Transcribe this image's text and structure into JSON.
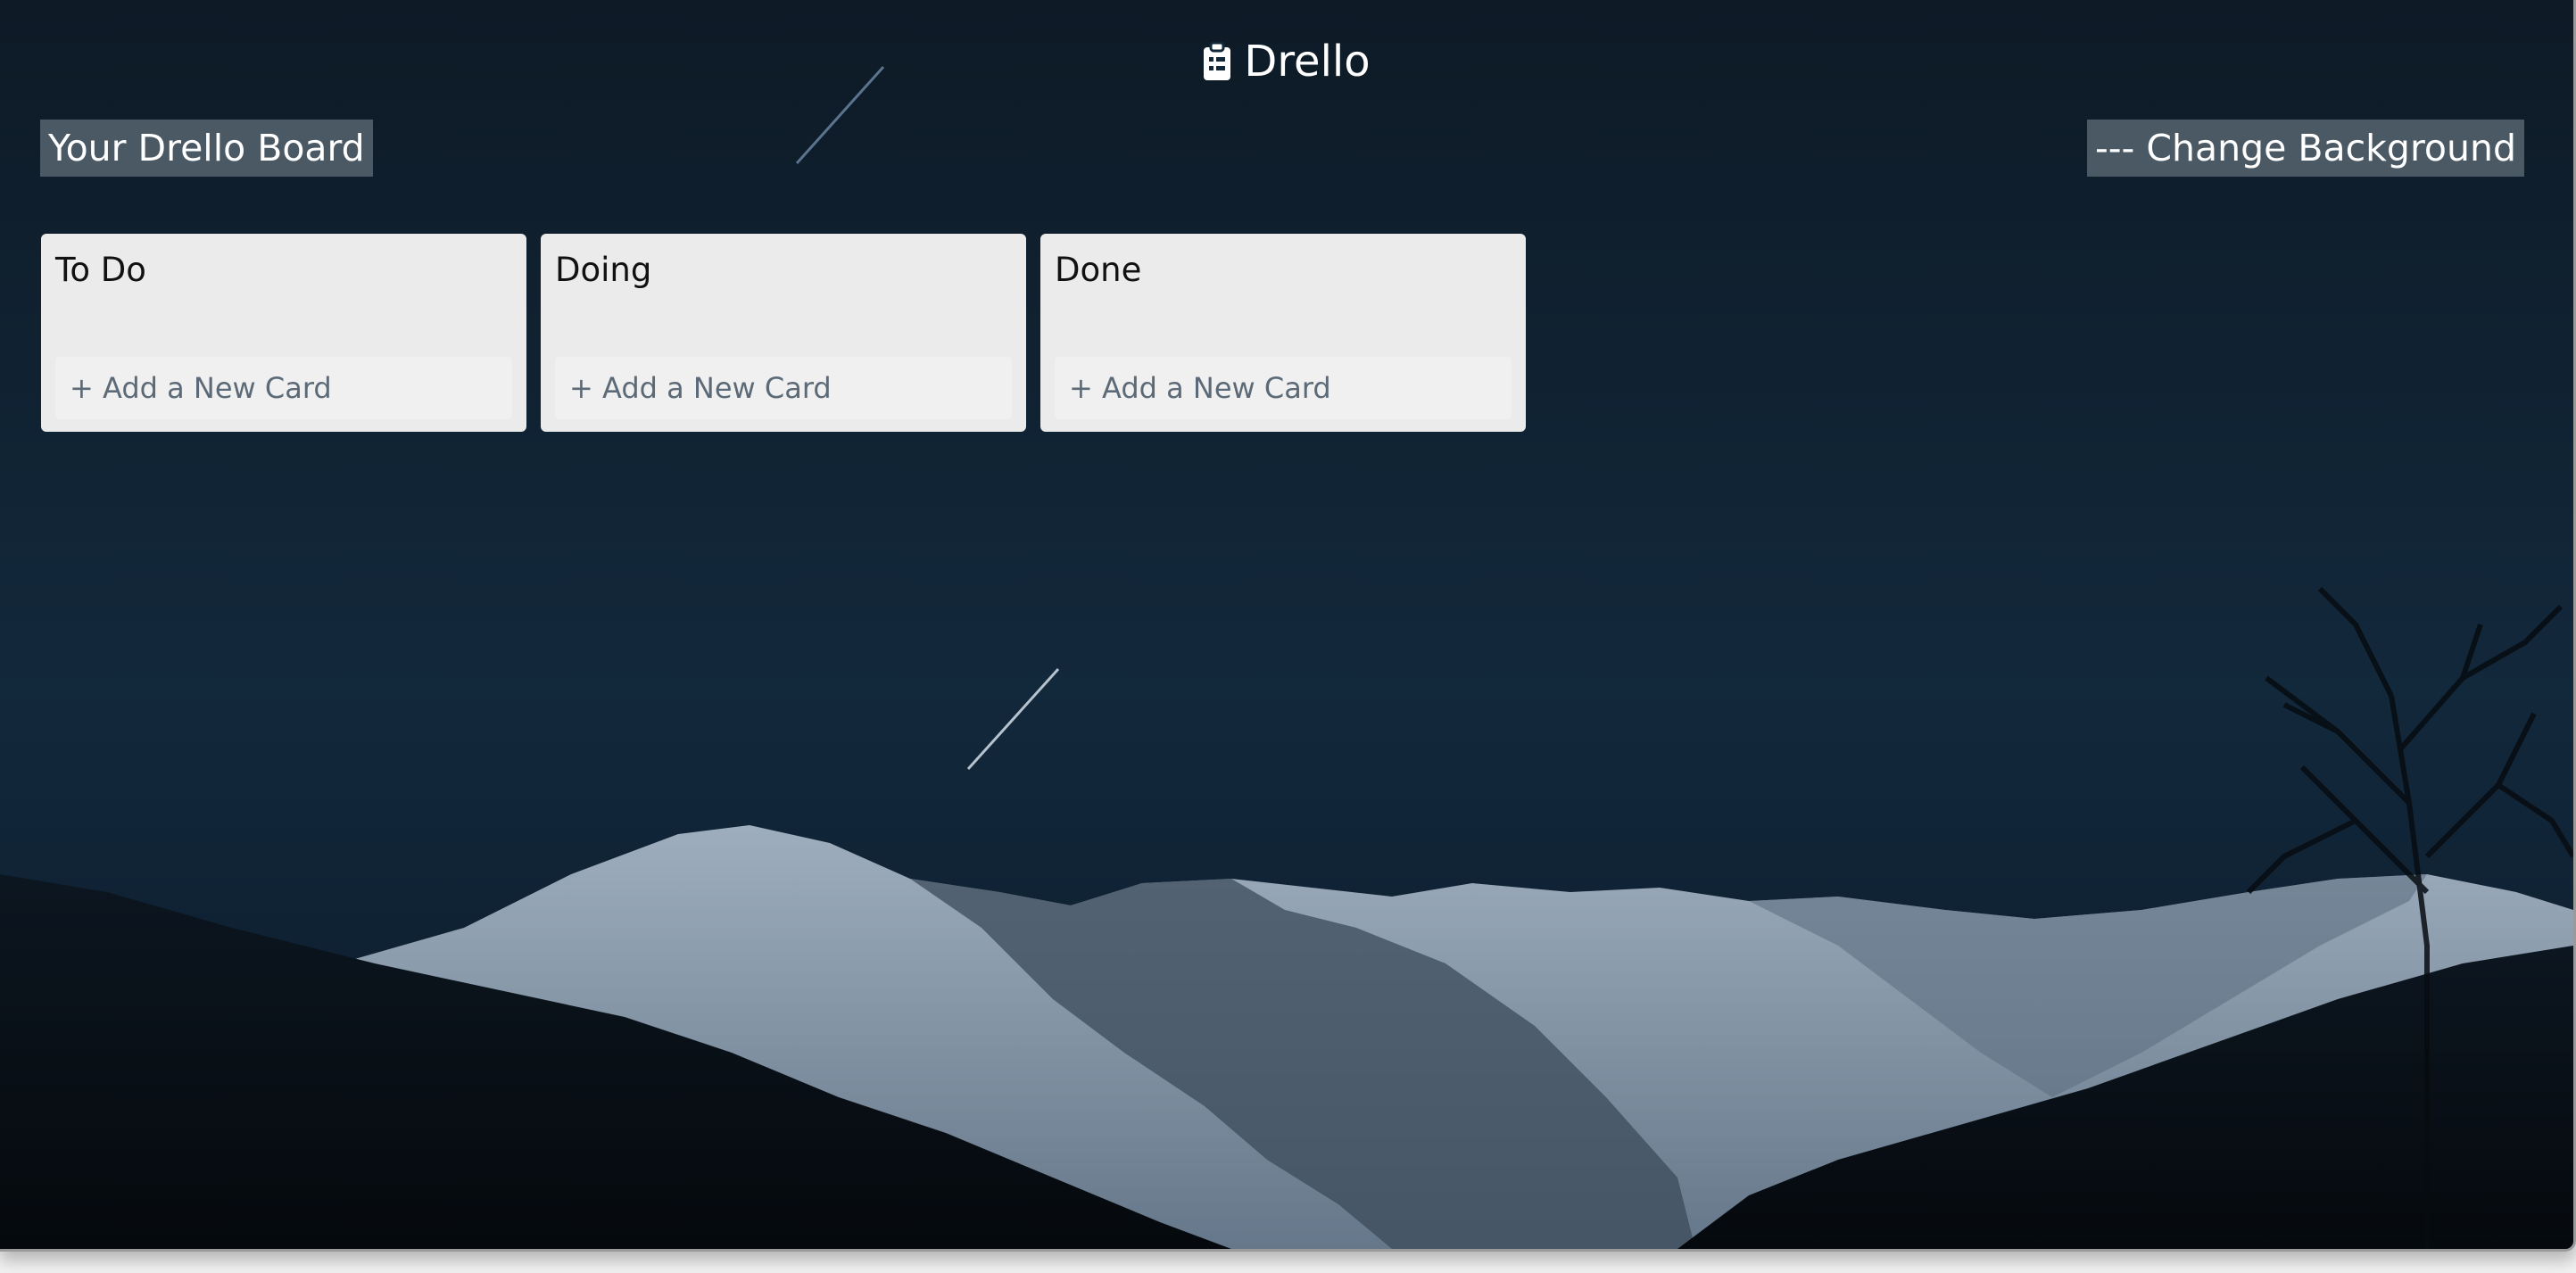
{
  "app": {
    "title": "Drello",
    "logo_icon": "clipboard-list-icon"
  },
  "board": {
    "title": "Your Drello Board",
    "change_background_label": "--- Change Background"
  },
  "lists": [
    {
      "title": "To Do",
      "add_card_label": "+ Add a New Card"
    },
    {
      "title": "Doing",
      "add_card_label": "+ Add a New Card"
    },
    {
      "title": "Done",
      "add_card_label": "+ Add a New Card"
    }
  ],
  "colors": {
    "list_background": "#ebebeb",
    "add_card_text": "#5c6a78",
    "header_button_background": "#7e8a94",
    "sky_top": "#0e1a26",
    "sky_mid": "#12283b",
    "snow": "#c9d5e2"
  }
}
